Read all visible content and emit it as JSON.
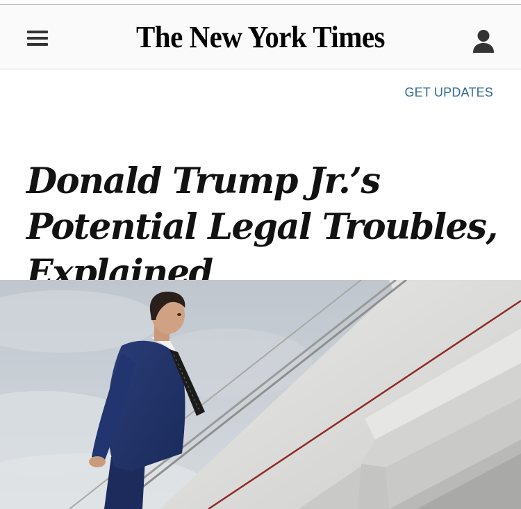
{
  "masthead": {
    "logo_text": "The New York Times",
    "menu_icon": "hamburger-menu-icon",
    "account_icon": "user-account-icon"
  },
  "updates": {
    "label": "GET UPDATES"
  },
  "article": {
    "headline": "Donald Trump Jr.’s Potential Legal Troubles, Explained",
    "hero_image": "photo-man-in-suit-climbing-aircraft-stairs"
  },
  "colors": {
    "link_blue": "#326891",
    "headline_text": "#121212",
    "masthead_bg": "#fafafa",
    "sky": "#c9cfd6"
  }
}
